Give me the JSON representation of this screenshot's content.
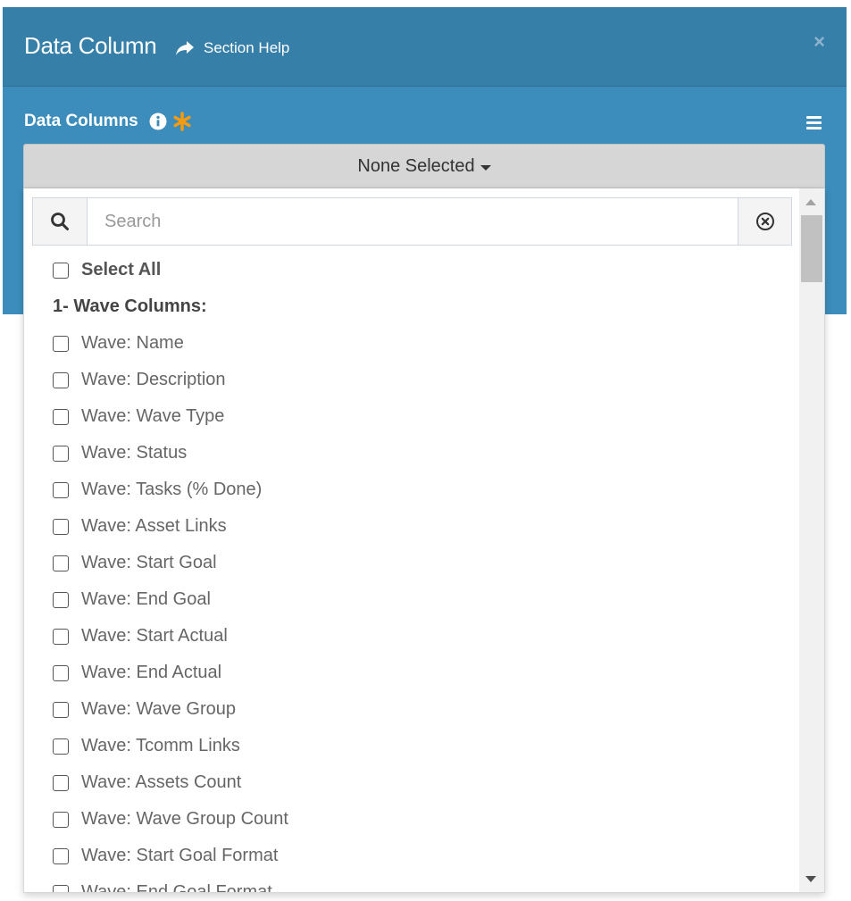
{
  "header": {
    "title": "Data Column",
    "help_label": "Section Help",
    "close_label": "×"
  },
  "section": {
    "label": "Data Columns"
  },
  "multiselect": {
    "button_label": "None Selected",
    "search_placeholder": "Search",
    "select_all_label": "Select All",
    "group_label": "1- Wave Columns:",
    "items": [
      "Wave: Name",
      "Wave: Description",
      "Wave: Wave Type",
      "Wave: Status",
      "Wave: Tasks (% Done)",
      "Wave: Asset Links",
      "Wave: Start Goal",
      "Wave: End Goal",
      "Wave: Start Actual",
      "Wave: End Actual",
      "Wave: Wave Group",
      "Wave: Tcomm Links",
      "Wave: Assets Count",
      "Wave: Wave Group Count",
      "Wave: Start Goal Format",
      "Wave: End Goal Format"
    ]
  },
  "colors": {
    "header_bg": "#367fa9",
    "body_bg": "#3c8dbc",
    "required_star": "#f39c12"
  },
  "icons": {
    "help": "share-arrow-icon",
    "info": "info-circle-icon",
    "required": "asterisk-icon",
    "menu": "hamburger-icon",
    "search": "search-icon",
    "clear": "clear-circle-icon"
  }
}
